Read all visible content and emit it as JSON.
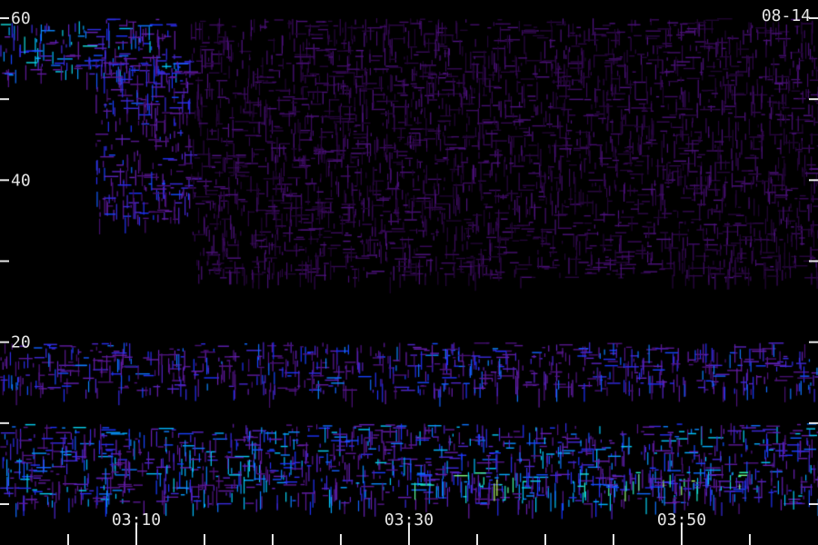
{
  "chart_data": {
    "type": "heatmap",
    "title": "",
    "date_label": "08-14",
    "xlabel": "",
    "ylabel": "",
    "x_tick_labels": [
      "03:10",
      "03:30",
      "03:50"
    ],
    "x_tick_minutes": [
      190,
      210,
      230
    ],
    "x_range_minutes": [
      180,
      240
    ],
    "x_minor_tick_step_minutes": 5,
    "y_tick_labels": [
      "60",
      "40",
      "20"
    ],
    "y_tick_values": [
      60,
      40,
      20
    ],
    "y_minor_tick_step": 10,
    "ylim": [
      0,
      60
    ],
    "colormap": [
      "#000000",
      "#3a0a5c",
      "#6a1fb0",
      "#1a33ff",
      "#00c8ff",
      "#30ffb0",
      "#ffff40"
    ],
    "bands": [
      {
        "ymin": 53,
        "ymax": 60,
        "xmin": 180,
        "xmax": 193,
        "intensity": 0.75
      },
      {
        "ymin": 35,
        "ymax": 55,
        "xmin": 187,
        "xmax": 194,
        "intensity": 0.55
      },
      {
        "ymin": 28,
        "ymax": 60,
        "xmin": 194,
        "xmax": 240,
        "intensity": 0.25
      },
      {
        "ymin": 14,
        "ymax": 20,
        "xmin": 180,
        "xmax": 240,
        "intensity": 0.6
      },
      {
        "ymin": 0,
        "ymax": 10,
        "xmin": 180,
        "xmax": 240,
        "intensity": 0.7
      },
      {
        "ymin": 2,
        "ymax": 4,
        "xmin": 210,
        "xmax": 235,
        "intensity": 0.95
      }
    ]
  }
}
